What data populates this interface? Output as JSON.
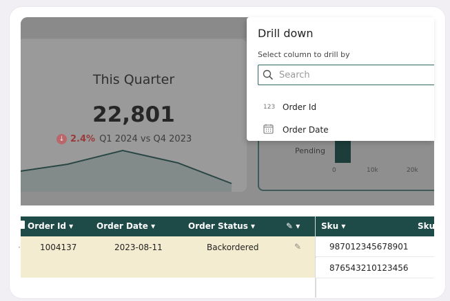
{
  "kpi": {
    "title": "This Quarter",
    "value": "22,801",
    "delta": "2.4%",
    "comparison": "Q1 2024 vs Q4 2023",
    "trend_icon": "arrow-down-circle-icon"
  },
  "bar_chart": {
    "category": "Pending",
    "ticks": [
      "0",
      "10k",
      "20k"
    ]
  },
  "drill_down": {
    "title": "Drill down",
    "subtitle": "Select column to drill by",
    "search_placeholder": "Search",
    "options": [
      {
        "type_label": "123",
        "label": "Order Id",
        "icon": "number-type-icon"
      },
      {
        "type_label": "",
        "label": "Order Date",
        "icon": "calendar-icon"
      }
    ]
  },
  "grid_left": {
    "columns": [
      "Order Id",
      "Order Date",
      "Order Status",
      "✎"
    ],
    "rows": [
      {
        "order_id": "1004137",
        "order_date": "2023-08-11",
        "order_status": "Backordered"
      }
    ]
  },
  "grid_right": {
    "columns": [
      "Sku",
      "Sku"
    ],
    "rows": [
      "987012345678901",
      "876543210123456"
    ]
  },
  "colors": {
    "header": "#1e4a48",
    "highlight_row": "#f3ecd0",
    "negative": "#9b3a3a"
  }
}
